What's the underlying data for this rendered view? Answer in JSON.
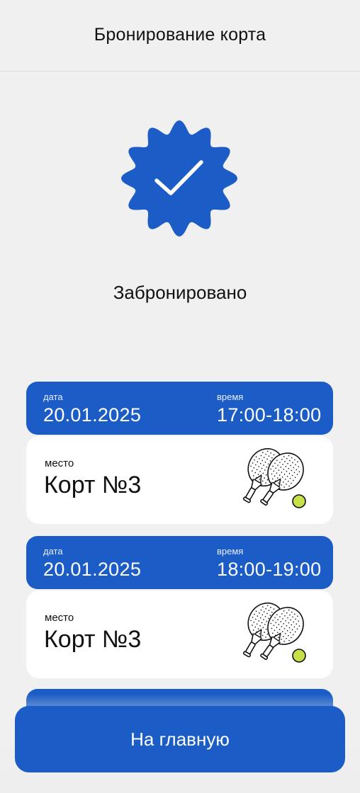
{
  "header": {
    "title": "Бронирование корта"
  },
  "status": {
    "icon": "verified-check-badge-icon",
    "text": "Забронировано"
  },
  "bookings": [
    {
      "date_label": "дата",
      "date": "20.01.2025",
      "time_label": "время",
      "time": "17:00-18:00",
      "place_label": "место",
      "place": "Корт №3",
      "icon": "padel-rackets-icon"
    },
    {
      "date_label": "дата",
      "date": "20.01.2025",
      "time_label": "время",
      "time": "18:00-19:00",
      "place_label": "место",
      "place": "Корт №3",
      "icon": "padel-rackets-icon"
    }
  ],
  "footer": {
    "home_label": "На главную"
  },
  "colors": {
    "accent": "#1b5cc6",
    "background": "#f0f0f0",
    "card": "#ffffff",
    "ball": "#c6e04a"
  }
}
